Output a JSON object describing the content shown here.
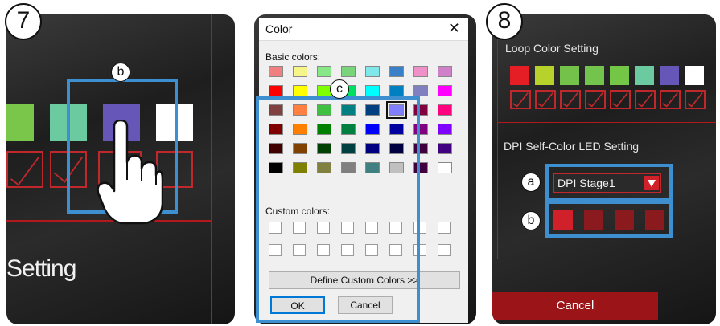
{
  "step7": {
    "badge": "7",
    "callout": "b",
    "partial_heading": "Setting",
    "swatches": [
      "#79c64b",
      "#6ccaa0",
      "#6656b8",
      "#ffffff"
    ]
  },
  "color_dialog": {
    "title": "Color",
    "close_glyph": "✕",
    "basic_colors_label": "Basic colors:",
    "custom_colors_label": "Custom colors:",
    "define_button": "Define Custom Colors >>",
    "ok_button": "OK",
    "cancel_button": "Cancel",
    "callout": "c",
    "basic_colors": [
      [
        "#f08080",
        "#f5f58a",
        "#88e888",
        "#7ad47a",
        "#80e8e8",
        "#3a80c8",
        "#f090c8",
        "#d080c8"
      ],
      [
        "#ff0000",
        "#ffff00",
        "#80ff00",
        "#00e060",
        "#00ffff",
        "#0080c0",
        "#8080c0",
        "#ff00ff"
      ],
      [
        "#804040",
        "#ff8040",
        "#40c040",
        "#008080",
        "#004080",
        "#8080ff",
        "#800040",
        "#ff0080"
      ],
      [
        "#800000",
        "#ff8000",
        "#008000",
        "#008040",
        "#0000ff",
        "#0000a0",
        "#800080",
        "#8000ff"
      ],
      [
        "#400000",
        "#804000",
        "#004000",
        "#004040",
        "#000080",
        "#000040",
        "#400040",
        "#400080"
      ],
      [
        "#000000",
        "#808000",
        "#808040",
        "#808080",
        "#408080",
        "#c0c0c0",
        "#400040",
        "#ffffff"
      ]
    ],
    "selected_color": "#8080ff"
  },
  "step8": {
    "badge": "8",
    "loop_title": "Loop Color Setting",
    "loop_swatches": [
      "#e41e24",
      "#b8d22c",
      "#74c24a",
      "#72c44c",
      "#74c646",
      "#6ccaa0",
      "#6656b8",
      "#ffffff"
    ],
    "dpi_title": "DPI Self-Color LED Setting",
    "dpi_stage_value": "DPI Stage1",
    "callout_a": "a",
    "callout_b": "b",
    "dpi_swatches": [
      "#d0202a",
      "#8a1a1e",
      "#8a1a1e",
      "#8a1a1e"
    ],
    "cancel_button": "Cancel"
  },
  "colors": {
    "accent_blue": "#3d8fd0",
    "accent_red": "#b3181c"
  }
}
